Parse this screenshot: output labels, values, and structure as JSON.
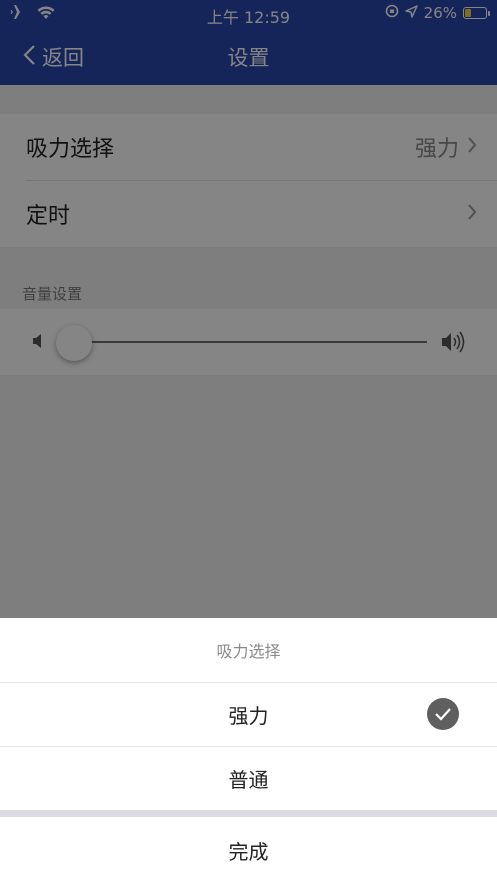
{
  "status_bar": {
    "time": "上午 12:59",
    "battery": "26%"
  },
  "nav": {
    "back_label": "返回",
    "title": "设置"
  },
  "settings": {
    "suction": {
      "label": "吸力选择",
      "value": "强力"
    },
    "timer": {
      "label": "定时"
    },
    "volume_section_title": "音量设置",
    "volume_level": 0.05
  },
  "sheet": {
    "title": "吸力选择",
    "options": [
      {
        "label": "强力",
        "selected": true
      },
      {
        "label": "普通",
        "selected": false
      }
    ],
    "done_label": "完成"
  },
  "colors": {
    "nav_bg": "#2948ad",
    "check_bg": "#5f5f5f"
  }
}
